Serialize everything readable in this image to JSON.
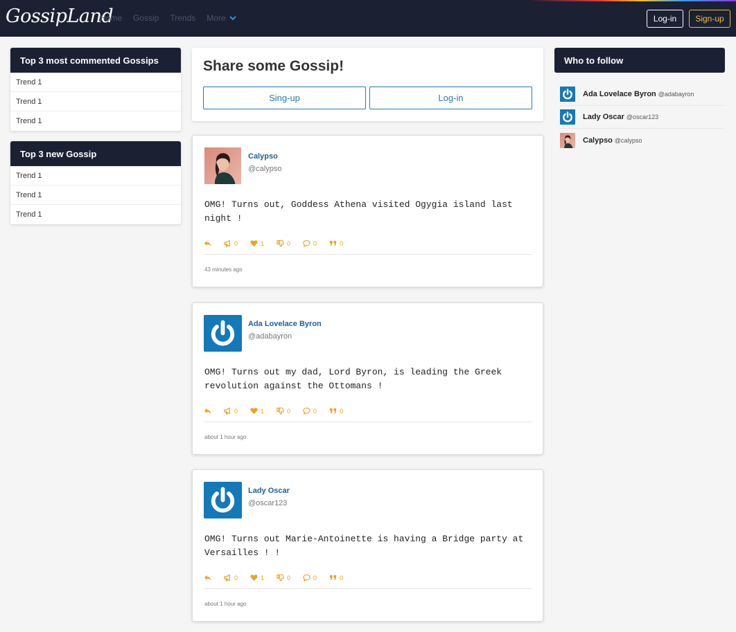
{
  "nav": {
    "brand": "GossipLand",
    "links": [
      "Home",
      "Gossip",
      "Trends"
    ],
    "more": "More",
    "login": "Log-in",
    "signup": "Sign-up"
  },
  "left": {
    "commented": {
      "title": "Top 3 most commented Gossips",
      "items": [
        "Trend 1",
        "Trend 1",
        "Trend 1"
      ]
    },
    "new": {
      "title": "Top 3 new Gossip",
      "items": [
        "Trend 1",
        "Trend 1",
        "Trend 1"
      ]
    }
  },
  "share": {
    "title": "Share some Gossip!",
    "signup": "Sing-up",
    "login": "Log-in"
  },
  "posts": [
    {
      "name": "Calypso",
      "handle": "@calypso",
      "avatar": "photo",
      "text": "OMG! Turns out, Goddess Athena visited Ogygia island last night !",
      "counts": {
        "megaphone": "0",
        "likes": "1",
        "dislikes": "0",
        "comments": "0",
        "quotes": "0"
      },
      "time": "43 minutes ago"
    },
    {
      "name": "Ada Lovelace Byron",
      "handle": "@adabayron",
      "avatar": "power",
      "text": "OMG! Turns out my dad, Lord Byron, is leading the Greek revolution against the Ottomans !",
      "counts": {
        "megaphone": "0",
        "likes": "1",
        "dislikes": "0",
        "comments": "0",
        "quotes": "0"
      },
      "time": "about 1 hour ago"
    },
    {
      "name": "Lady Oscar",
      "handle": "@oscar123",
      "avatar": "power",
      "text": "OMG! Turns out Marie-Antoinette is having a Bridge party at Versailles ! !",
      "counts": {
        "megaphone": "0",
        "likes": "1",
        "dislikes": "0",
        "comments": "0",
        "quotes": "0"
      },
      "time": "about 1 hour ago"
    }
  ],
  "follow": {
    "title": "Who to follow",
    "users": [
      {
        "name": "Ada Lovelace Byron",
        "handle": "@adabayron",
        "avatar": "power"
      },
      {
        "name": "Lady Oscar",
        "handle": "@oscar123",
        "avatar": "power"
      },
      {
        "name": "Calypso",
        "handle": "@calypso",
        "avatar": "photo"
      }
    ]
  },
  "colors": {
    "navbar": "#1b2033",
    "accent": "#f0a020",
    "link": "#1f5f96",
    "button": "#2a7ab0",
    "signup": "#f2c12e"
  }
}
